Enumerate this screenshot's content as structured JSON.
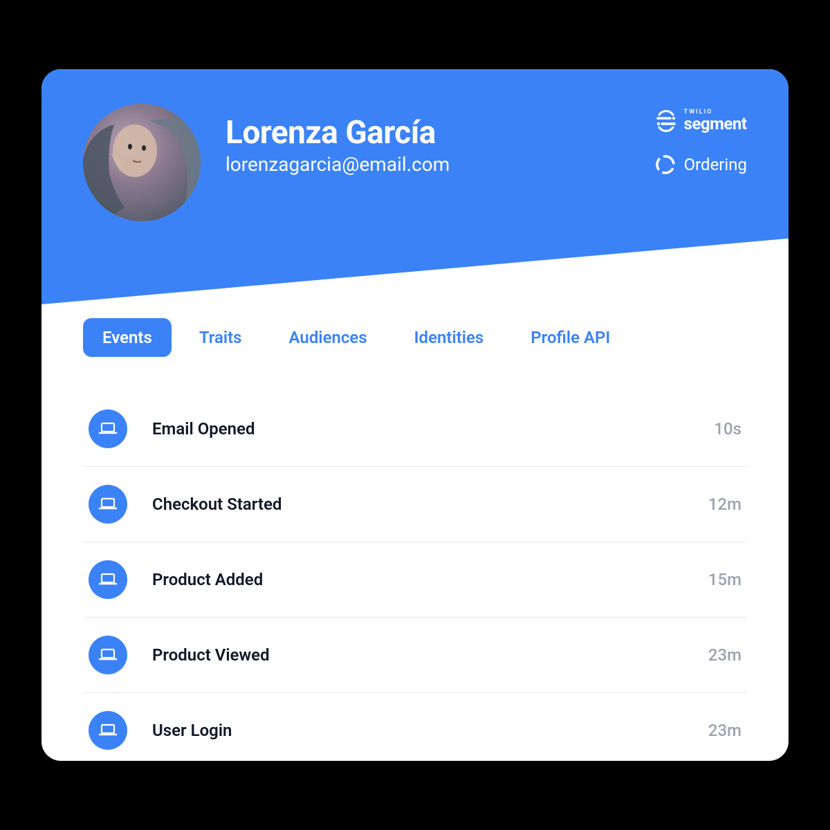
{
  "user": {
    "name": "Lorenza García",
    "email": "lorenzagarcia@email.com"
  },
  "logos": {
    "segment_twilio": "TWILIO",
    "segment_name": "segment",
    "ordering_name": "Ordering"
  },
  "tabs": [
    {
      "label": "Events",
      "active": true
    },
    {
      "label": "Traits",
      "active": false
    },
    {
      "label": "Audiences",
      "active": false
    },
    {
      "label": "Identities",
      "active": false
    },
    {
      "label": "Profile API",
      "active": false
    }
  ],
  "events": [
    {
      "icon": "laptop-icon",
      "name": "Email Opened",
      "time": "10s"
    },
    {
      "icon": "laptop-icon",
      "name": "Checkout Started",
      "time": "12m"
    },
    {
      "icon": "laptop-icon",
      "name": "Product Added",
      "time": "15m"
    },
    {
      "icon": "laptop-icon",
      "name": "Product Viewed",
      "time": "23m"
    },
    {
      "icon": "laptop-icon",
      "name": "User Login",
      "time": "23m"
    }
  ],
  "colors": {
    "primary": "#3b82f6",
    "text_dark": "#111827",
    "text_muted": "#9ca3af",
    "border": "#e5e7eb"
  }
}
